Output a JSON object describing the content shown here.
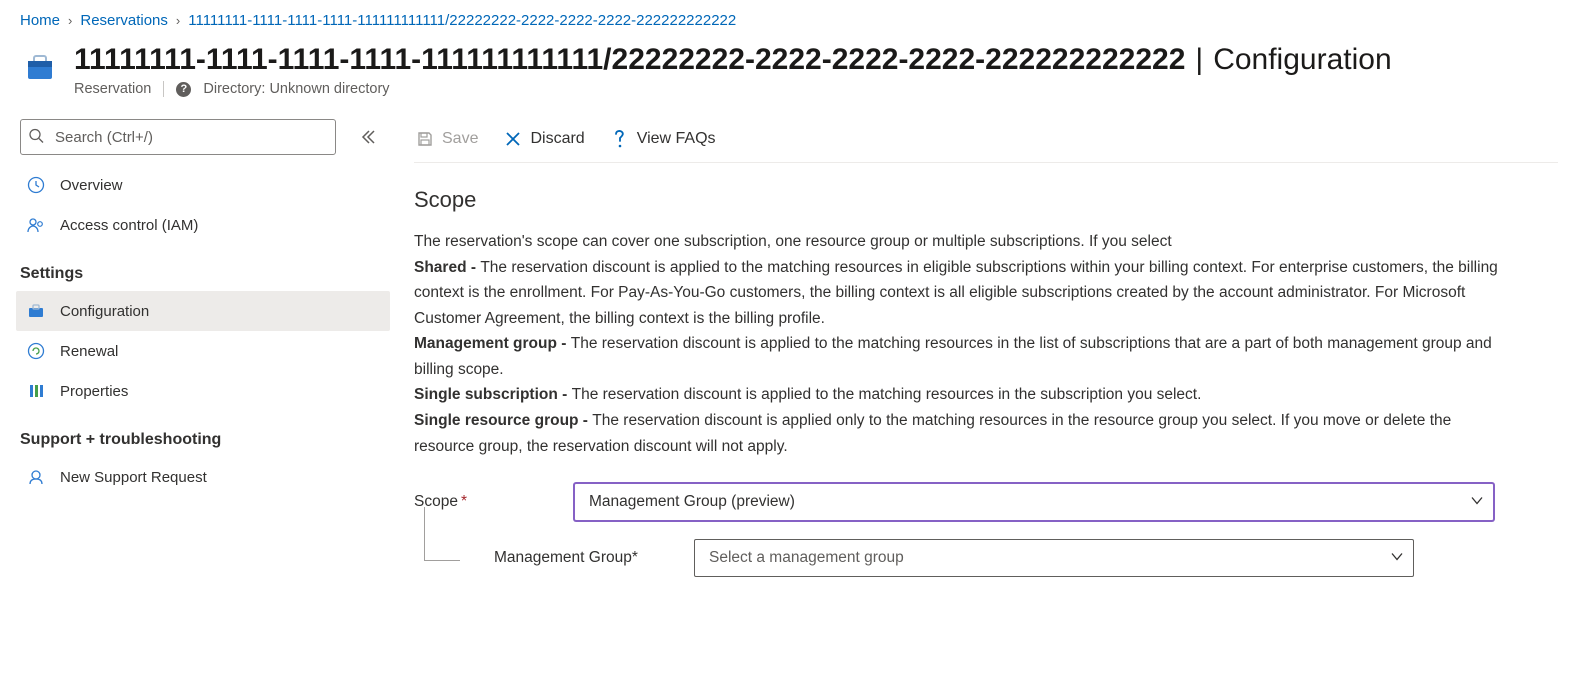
{
  "breadcrumb": {
    "home": "Home",
    "reservations": "Reservations",
    "current": "11111111-1111-1111-1111-111111111111/22222222-2222-2222-2222-222222222222"
  },
  "header": {
    "title": "11111111-1111-1111-1111-111111111111/22222222-2222-2222-2222-222222222222",
    "section": "Configuration",
    "resource_type": "Reservation",
    "directory_label": "Directory: Unknown directory"
  },
  "sidebar": {
    "search_placeholder": "Search (Ctrl+/)",
    "overview": "Overview",
    "access_control": "Access control (IAM)",
    "section_settings": "Settings",
    "configuration": "Configuration",
    "renewal": "Renewal",
    "properties": "Properties",
    "section_support": "Support + troubleshooting",
    "new_support": "New Support Request"
  },
  "toolbar": {
    "save": "Save",
    "discard": "Discard",
    "faqs": "View FAQs"
  },
  "scope": {
    "title": "Scope",
    "intro": "The reservation's scope can cover one subscription, one resource group or multiple subscriptions. If you select",
    "shared_label": "Shared - ",
    "shared_text": "The reservation discount is applied to the matching resources in eligible subscriptions within your billing context. For enterprise customers, the billing context is the enrollment. For Pay-As-You-Go customers, the billing context is all eligible subscriptions created by the account administrator. For Microsoft Customer Agreement, the billing context is the billing profile.",
    "mg_label": "Management group - ",
    "mg_text": "The reservation discount is applied to the matching resources in the list of subscriptions that are a part of both management group and billing scope.",
    "single_sub_label": "Single subscription - ",
    "single_sub_text": "The reservation discount is applied to the matching resources in the subscription you select.",
    "single_rg_label": "Single resource group - ",
    "single_rg_text": "The reservation discount is applied only to the matching resources in the resource group you select. If you move or delete the resource group, the reservation discount will not apply."
  },
  "form": {
    "scope_label": "Scope",
    "scope_value": "Management Group (preview)",
    "mg_label": "Management Group",
    "mg_placeholder": "Select a management group"
  }
}
